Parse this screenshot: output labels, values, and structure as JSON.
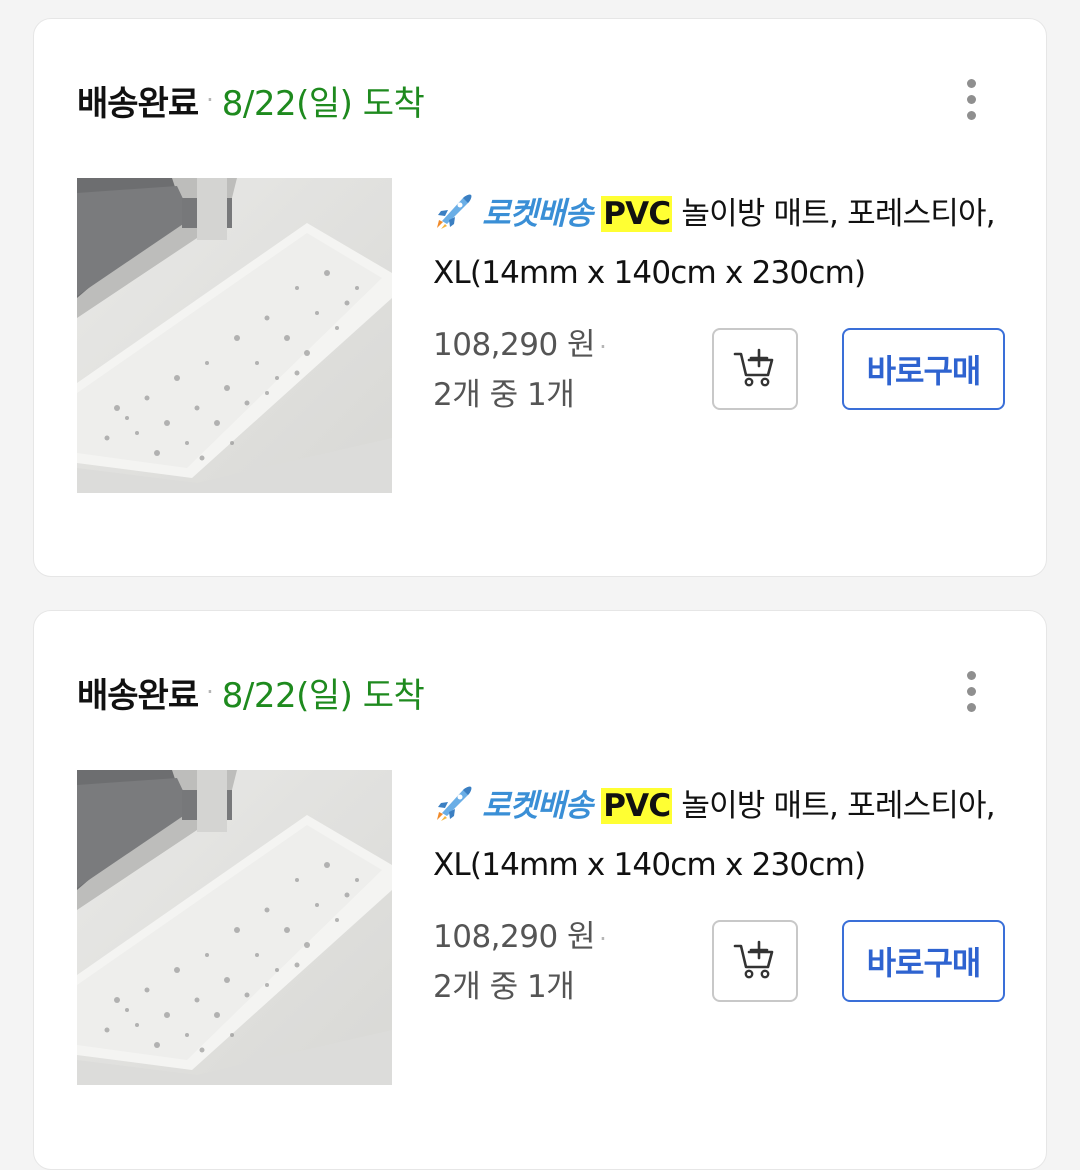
{
  "orders": [
    {
      "status": "배송완료",
      "separator": "·",
      "arrival": "8/22(일) 도착",
      "rocket_label": "로켓배송",
      "title_highlight": "PVC",
      "title_rest": "놀이방 매트, 포레스티아, XL(14mm x 140cm x 230cm)",
      "price": "108,290 원",
      "price_separator": "·",
      "quantity": "2개 중 1개",
      "buy_now_label": "바로구매"
    },
    {
      "status": "배송완료",
      "separator": "·",
      "arrival": "8/22(일) 도착",
      "rocket_label": "로켓배송",
      "title_highlight": "PVC",
      "title_rest": "놀이방 매트, 포레스티아, XL(14mm x 140cm x 230cm)",
      "price": "108,290 원",
      "price_separator": "·",
      "quantity": "2개 중 1개",
      "buy_now_label": "바로구매"
    }
  ],
  "icons": {
    "more": "more-vertical-icon",
    "rocket": "rocket-icon",
    "cart": "add-to-cart-icon"
  },
  "colors": {
    "arrival": "#1e8a1e",
    "rocket_label": "#3a8fd6",
    "highlight": "#ffff33",
    "buy_button": "#2e63d0"
  }
}
